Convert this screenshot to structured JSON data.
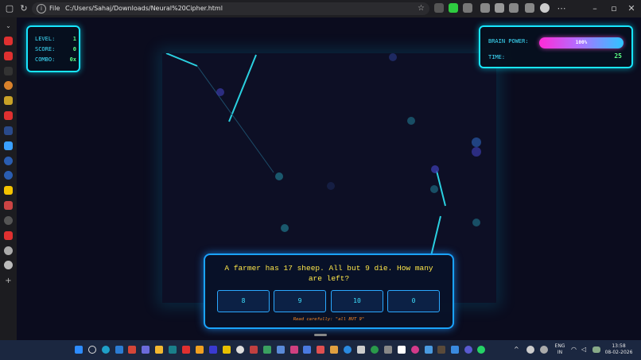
{
  "browser": {
    "file_label": "File",
    "url": "C:/Users/Sahaj/Downloads/Neural%20Cipher.html"
  },
  "stats": {
    "level_label": "LEVEL:",
    "level": "1",
    "score_label": "SCORE:",
    "score": "0",
    "combo_label": "COMBO:",
    "combo": "0x"
  },
  "power": {
    "label": "BRAIN POWER:",
    "percent_text": "100%",
    "level": 1.0,
    "time_label": "TIME:",
    "time": "25"
  },
  "quiz": {
    "question": "A farmer has 17 sheep. All but 9 die. How many are left?",
    "options": [
      "8",
      "9",
      "10",
      "0"
    ],
    "hint": "Read carefully: \"all BUT 9\""
  },
  "taskbar": {
    "lang": "ENG",
    "region": "IN",
    "time": "13:58",
    "date": "08-02-2026"
  },
  "colors": {
    "accent": "#18e6ff",
    "value": "#5dff85",
    "question": "#ffe84a",
    "hint": "#ff8a24"
  }
}
